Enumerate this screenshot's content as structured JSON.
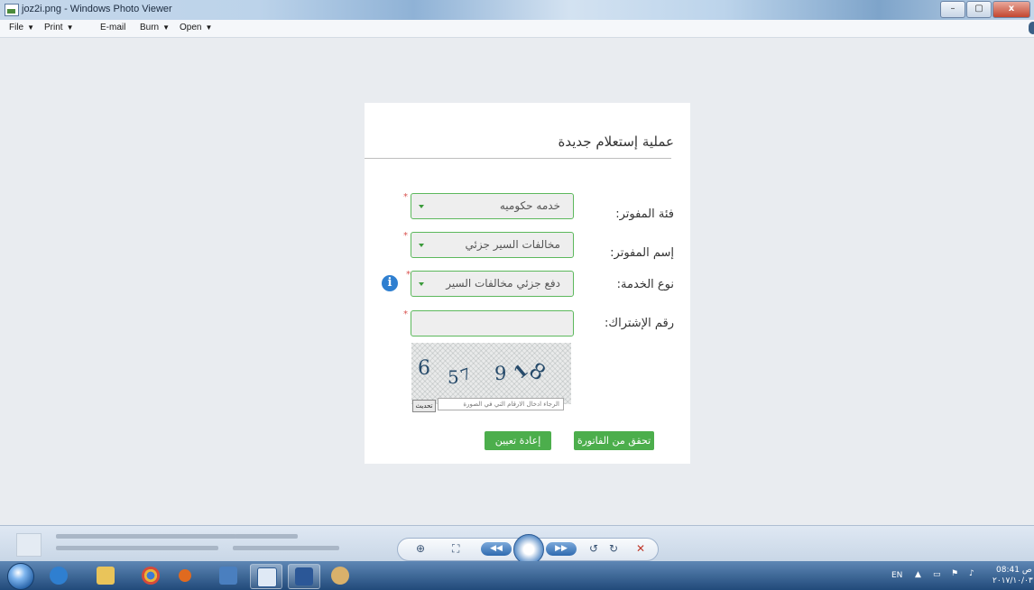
{
  "window": {
    "title": "joz2i.png - Windows Photo Viewer",
    "controls": {
      "minimize": "–",
      "maximize": "▢",
      "close": "x"
    }
  },
  "menu": [
    {
      "label": "File",
      "has_dropdown": true
    },
    {
      "label": "Print",
      "has_dropdown": true
    },
    {
      "label": "E-mail",
      "has_dropdown": false
    },
    {
      "label": "Burn",
      "has_dropdown": true
    },
    {
      "label": "Open",
      "has_dropdown": true
    }
  ],
  "menu_arrow": "▼",
  "form": {
    "title": "عملية إستعلام جديدة",
    "fields": [
      {
        "label": "فئة المفوتر:",
        "value": "خدمه حكوميه",
        "required": true
      },
      {
        "label": "إسم المفوتر:",
        "value": "مخالفات السير جزئي",
        "required": true
      },
      {
        "label": "نوع الخدمة:",
        "value": "دفع جزئي مخالفات السير",
        "required": true
      },
      {
        "label": "رقم الإشتراك:",
        "value": "",
        "required": true
      }
    ],
    "required_mark": "*",
    "info_icon_text": "i",
    "captcha": {
      "digits": [
        "6",
        "5",
        "7",
        "9",
        "1",
        "8"
      ],
      "refresh_label": "تحديث",
      "input_placeholder": "الرجاء ادخال الارقام التي في الصورة"
    },
    "buttons": {
      "verify": "تحقق من الفاتورة",
      "reset": "إعادة تعيين"
    }
  },
  "taskbar": {
    "language": "EN",
    "time": "08:41 ص",
    "date": "٢٠١٧/١٠/٠٣"
  },
  "colors": {
    "accent_green": "#4cae4c",
    "field_border": "#5cb85c",
    "required_red": "#d9534f",
    "info_blue": "#2f7fd0"
  }
}
